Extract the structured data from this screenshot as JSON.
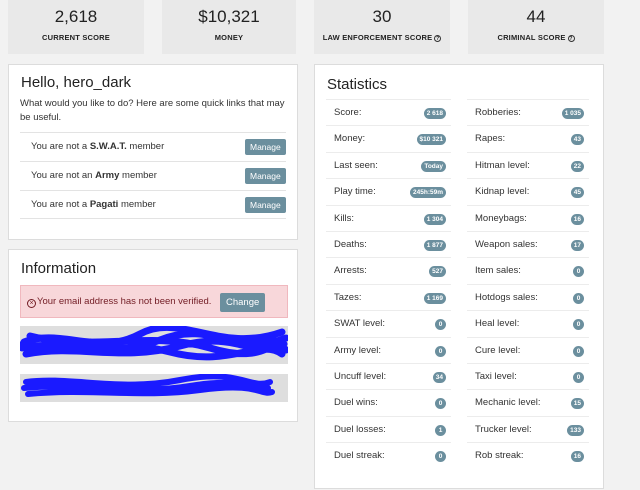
{
  "top_stats": [
    {
      "value": "2,618",
      "label": "CURRENT SCORE",
      "help": false
    },
    {
      "value": "$10,321",
      "label": "MONEY",
      "help": false
    },
    {
      "value": "30",
      "label": "LAW ENFORCEMENT SCORE",
      "help": true
    },
    {
      "value": "44",
      "label": "CRIMINAL SCORE",
      "help": true
    }
  ],
  "hello": {
    "title": "Hello, hero_dark",
    "intro": "What would you like to do? Here are some quick links that may be useful.",
    "memberships": [
      {
        "prefix": "You are not a ",
        "group": "S.W.A.T.",
        "suffix": " member",
        "button": "Manage"
      },
      {
        "prefix": "You are not an ",
        "group": "Army",
        "suffix": " member",
        "button": "Manage"
      },
      {
        "prefix": "You are not a ",
        "group": "Pagati",
        "suffix": " member",
        "button": "Manage"
      }
    ]
  },
  "information": {
    "title": "Information",
    "alert_text": "Your email address has not been verified.",
    "alert_button": "Change",
    "help_icon": "question-circle-icon",
    "alert_icon": "x-circle-icon",
    "redaction_color": "#1a1aff"
  },
  "statistics": {
    "title": "Statistics",
    "left": [
      {
        "key": "Score:",
        "value": "2 618"
      },
      {
        "key": "Money:",
        "value": "$10 321"
      },
      {
        "key": "Last seen:",
        "value": "Today"
      },
      {
        "key": "Play time:",
        "value": "245h:59m"
      },
      {
        "key": "Kills:",
        "value": "1 304"
      },
      {
        "key": "Deaths:",
        "value": "1 877"
      },
      {
        "key": "Arrests:",
        "value": "527"
      },
      {
        "key": "Tazes:",
        "value": "1 169"
      },
      {
        "key": "SWAT level:",
        "value": "0"
      },
      {
        "key": "Army level:",
        "value": "0"
      },
      {
        "key": "Uncuff level:",
        "value": "34"
      },
      {
        "key": "Duel wins:",
        "value": "0"
      },
      {
        "key": "Duel losses:",
        "value": "1"
      },
      {
        "key": "Duel streak:",
        "value": "0"
      }
    ],
    "right": [
      {
        "key": "Robberies:",
        "value": "1 035"
      },
      {
        "key": "Rapes:",
        "value": "43"
      },
      {
        "key": "Hitman level:",
        "value": "22"
      },
      {
        "key": "Kidnap level:",
        "value": "45"
      },
      {
        "key": "Moneybags:",
        "value": "16"
      },
      {
        "key": "Weapon sales:",
        "value": "17"
      },
      {
        "key": "Item sales:",
        "value": "0"
      },
      {
        "key": "Hotdogs sales:",
        "value": "0"
      },
      {
        "key": "Heal level:",
        "value": "0"
      },
      {
        "key": "Cure level:",
        "value": "0"
      },
      {
        "key": "Taxi level:",
        "value": "0"
      },
      {
        "key": "Mechanic level:",
        "value": "15"
      },
      {
        "key": "Trucker level:",
        "value": "133"
      },
      {
        "key": "Rob streak:",
        "value": "16"
      }
    ]
  },
  "colors": {
    "accent": "#6b8f9e",
    "alert_bg": "#f8d7da",
    "alert_text": "#721c24"
  }
}
